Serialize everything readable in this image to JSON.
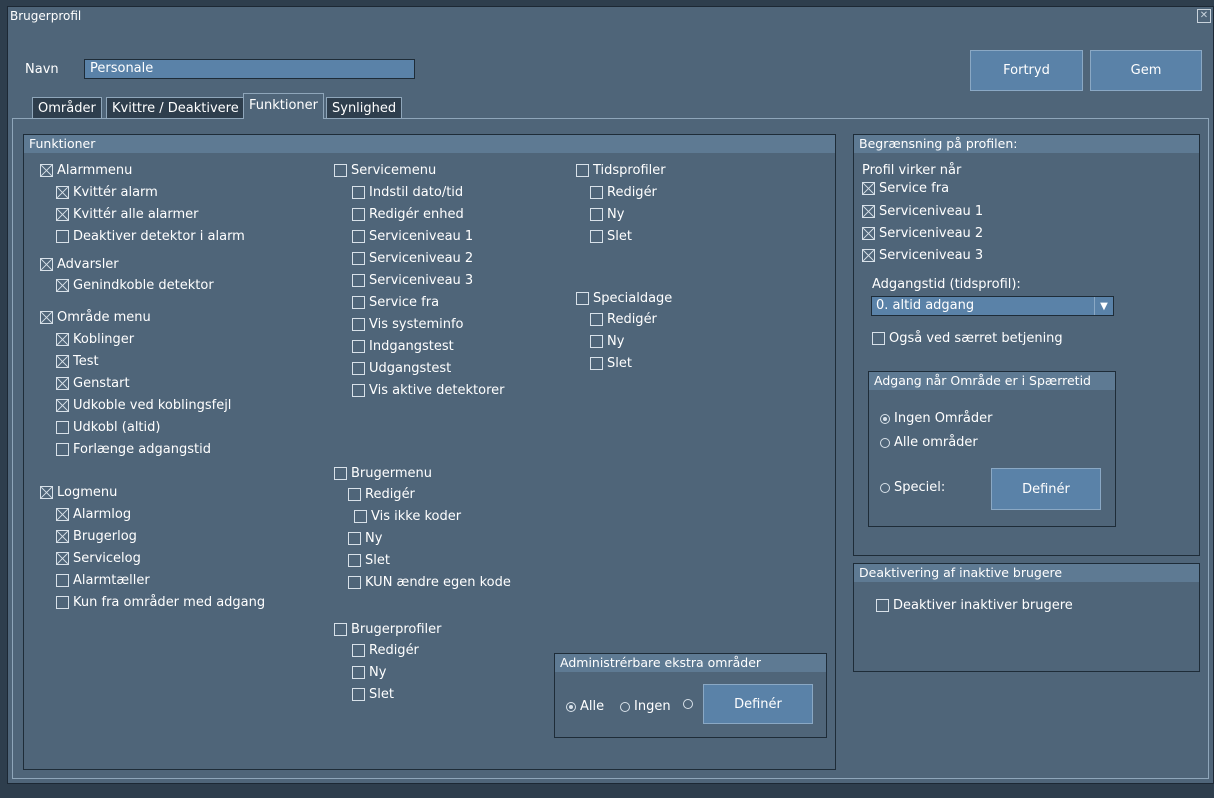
{
  "window": {
    "title": "Brugerprofil",
    "close": "✕"
  },
  "name": {
    "label": "Navn",
    "value": "Personale"
  },
  "buttons": {
    "undo": "Fortryd",
    "save": "Gem"
  },
  "tabs": [
    "Områder",
    "Kvittre / Deaktivere",
    "Funktioner",
    "Synlighed"
  ],
  "functions": {
    "title": "Funktioner",
    "col1": [
      {
        "label": "Alarmmenu",
        "checked": true
      },
      {
        "label": "Kvittér alarm",
        "checked": true
      },
      {
        "label": "Kvittér alle alarmer",
        "checked": true
      },
      {
        "label": "Deaktiver detektor i alarm",
        "checked": false
      },
      {
        "label": "Advarsler",
        "checked": true
      },
      {
        "label": "Genindkoble detektor",
        "checked": true
      },
      {
        "label": "Område menu",
        "checked": true
      },
      {
        "label": "Koblinger",
        "checked": true
      },
      {
        "label": "Test",
        "checked": true
      },
      {
        "label": "Genstart",
        "checked": true
      },
      {
        "label": "Udkoble ved koblingsfejl",
        "checked": true
      },
      {
        "label": "Udkobl (altid)",
        "checked": false
      },
      {
        "label": "Forlænge adgangstid",
        "checked": false
      },
      {
        "label": "Logmenu",
        "checked": true
      },
      {
        "label": "Alarmlog",
        "checked": true
      },
      {
        "label": "Brugerlog",
        "checked": true
      },
      {
        "label": "Servicelog",
        "checked": true
      },
      {
        "label": "Alarmtæller",
        "checked": false
      },
      {
        "label": "Kun fra områder med adgang",
        "checked": false
      }
    ],
    "col2": [
      {
        "label": "Servicemenu",
        "checked": false
      },
      {
        "label": "Indstil dato/tid",
        "checked": false
      },
      {
        "label": "Redigér enhed",
        "checked": false
      },
      {
        "label": "Serviceniveau 1",
        "checked": false
      },
      {
        "label": "Serviceniveau 2",
        "checked": false
      },
      {
        "label": "Serviceniveau 3",
        "checked": false
      },
      {
        "label": "Service fra",
        "checked": false
      },
      {
        "label": "Vis systeminfo",
        "checked": false
      },
      {
        "label": "Indgangstest",
        "checked": false
      },
      {
        "label": "Udgangstest",
        "checked": false
      },
      {
        "label": "Vis aktive detektorer",
        "checked": false
      },
      {
        "label": "Brugermenu",
        "checked": false
      },
      {
        "label": "Redigér",
        "checked": false
      },
      {
        "label": "Vis ikke koder",
        "checked": false
      },
      {
        "label": "Ny",
        "checked": false
      },
      {
        "label": "Slet",
        "checked": false
      },
      {
        "label": "KUN ændre egen kode",
        "checked": false
      },
      {
        "label": "Brugerprofiler",
        "checked": false
      },
      {
        "label": "Redigér",
        "checked": false
      },
      {
        "label": "Ny",
        "checked": false
      },
      {
        "label": "Slet",
        "checked": false
      }
    ],
    "col3": [
      {
        "label": "Tidsprofiler",
        "checked": false
      },
      {
        "label": "Redigér",
        "checked": false
      },
      {
        "label": "Ny",
        "checked": false
      },
      {
        "label": "Slet",
        "checked": false
      },
      {
        "label": "Specialdage",
        "checked": false
      },
      {
        "label": "Redigér",
        "checked": false
      },
      {
        "label": "Ny",
        "checked": false
      },
      {
        "label": "Slet",
        "checked": false
      }
    ],
    "admin_extra": {
      "title": "Administrérbare ekstra områder",
      "options": [
        {
          "label": "Alle",
          "checked": true
        },
        {
          "label": "Ingen",
          "checked": false
        },
        {
          "label": "",
          "checked": false
        }
      ],
      "define": "Definér"
    }
  },
  "restriction": {
    "title": "Begrænsning på profilen:",
    "active_when": "Profil virker når",
    "items": [
      {
        "label": "Service fra",
        "checked": true
      },
      {
        "label": "Serviceniveau 1",
        "checked": true
      },
      {
        "label": "Serviceniveau 2",
        "checked": true
      },
      {
        "label": "Serviceniveau 3",
        "checked": true
      }
    ],
    "access_time_label": "Adgangstid (tidsprofil):",
    "access_time_value": "0. altid adgang",
    "special_operation": {
      "label": "Også ved særret betjening",
      "checked": false
    },
    "lock_access": {
      "title": "Adgang når Område er i Spærretid",
      "options": [
        {
          "label": "Ingen Områder",
          "checked": true
        },
        {
          "label": "Alle områder",
          "checked": false
        },
        {
          "label": "Speciel:",
          "checked": false
        }
      ],
      "define": "Definér"
    }
  },
  "deactivation": {
    "title": "Deaktivering af inaktive brugere",
    "item": {
      "label": "Deaktiver inaktiver brugere",
      "checked": false
    }
  }
}
